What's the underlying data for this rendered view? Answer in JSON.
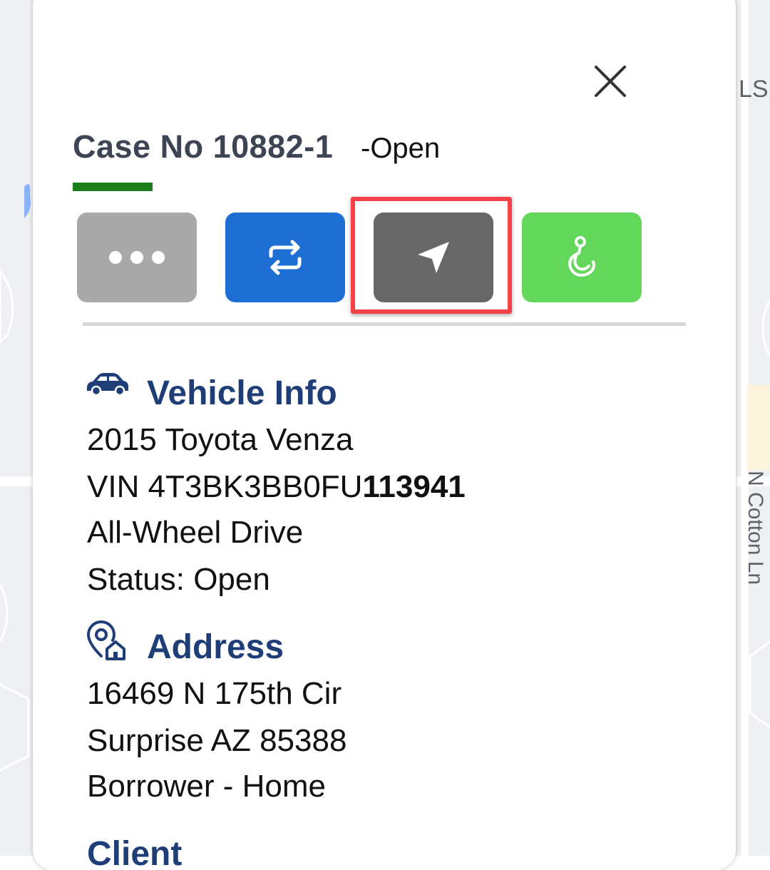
{
  "map": {
    "label_ls": "LS",
    "label_street": "N Cotton Ln"
  },
  "case": {
    "title": "Case No 10882-1",
    "status": "-Open"
  },
  "actions": {
    "more_icon": "more-dots-icon",
    "swap_icon": "swap-arrows-icon",
    "navigate_icon": "navigate-arrow-icon",
    "tow_icon": "tow-hook-icon"
  },
  "vehicle": {
    "heading": "Vehicle Info",
    "model": "2015 Toyota Venza",
    "vin_prefix": "VIN 4T3BK3BB0FU",
    "vin_suffix": "113941",
    "drive": "All-Wheel Drive",
    "status": "Status:  Open"
  },
  "address": {
    "heading": "Address",
    "street": "16469 N 175th Cir",
    "city": "Surprise AZ 85388",
    "type": "Borrower - Home"
  },
  "client": {
    "heading": "Client"
  },
  "colors": {
    "more": "#a9a9a9",
    "swap": "#1e6fd4",
    "navigate": "#676767",
    "tow": "#63d75a",
    "heading": "#1f3e78",
    "highlight": "#f44248"
  }
}
